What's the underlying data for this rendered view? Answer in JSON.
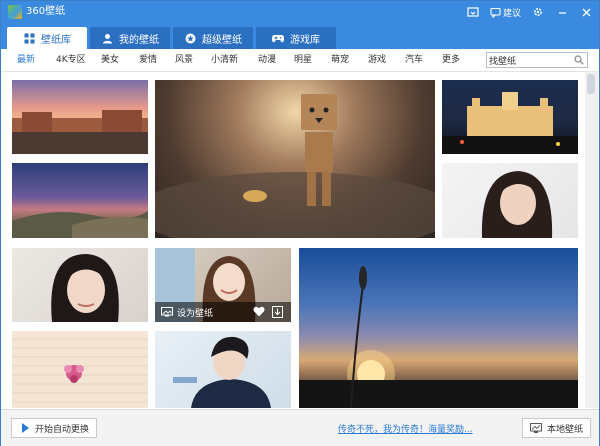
{
  "window": {
    "title": "360壁纸"
  },
  "titlebar": {
    "suggest_label": "建议"
  },
  "tabs": [
    {
      "label": "壁纸库",
      "icon": "grid-icon"
    },
    {
      "label": "我的壁纸",
      "icon": "user-icon"
    },
    {
      "label": "超级壁纸",
      "icon": "star-badge-icon"
    },
    {
      "label": "游戏库",
      "icon": "gamepad-icon"
    }
  ],
  "categories": [
    "最新",
    "4K专区",
    "美女",
    "爱情",
    "风景",
    "小清新",
    "动漫",
    "明星",
    "萌宠",
    "游戏",
    "汽车",
    "更多"
  ],
  "search": {
    "value": "找壁纸"
  },
  "gallery": {
    "tiles": [
      {
        "name": "tile-plaza-sunset",
        "desc": "city plaza at sunset"
      },
      {
        "name": "tile-danbo",
        "desc": "cardboard robot on pavement"
      },
      {
        "name": "tile-palace-night",
        "desc": "illuminated palace at night"
      },
      {
        "name": "tile-coast-dusk",
        "desc": "coastal hills at dusk"
      },
      {
        "name": "tile-portrait-woman-1",
        "desc": "portrait woman white background"
      },
      {
        "name": "tile-portrait-woman-2",
        "desc": "portrait woman dark hair"
      },
      {
        "name": "tile-portrait-woman-3",
        "desc": "smiling woman, hovered"
      },
      {
        "name": "tile-grass-sunset",
        "desc": "grass stalk against sunset"
      },
      {
        "name": "tile-flower-wood",
        "desc": "flower on wooden planks"
      },
      {
        "name": "tile-portrait-man",
        "desc": "young man portrait"
      }
    ],
    "hover_overlay": {
      "set_label": "设为壁纸"
    }
  },
  "footer": {
    "auto_change_label": "开始自动更换",
    "promo_text": "传奇不死，我为传奇！海量奖励...",
    "local_wallpaper_label": "本地壁纸"
  },
  "colors": {
    "accent": "#3a8be0",
    "tab_inactive": "#2a6fc0",
    "link": "#2a7ad5"
  }
}
